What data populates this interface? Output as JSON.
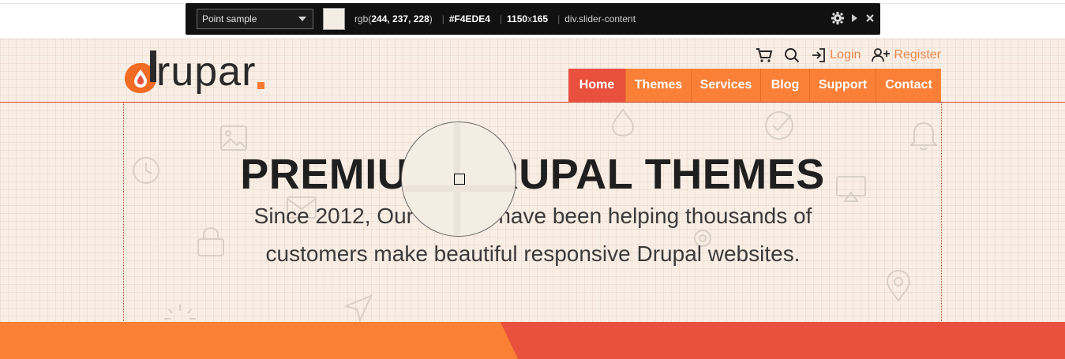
{
  "picker": {
    "mode": "Point sample",
    "rgb_prefix": "rgb(",
    "rgb_values": "244, 237, 228",
    "rgb_suffix": ")",
    "hex": "#F4EDE4",
    "width": "1150",
    "x_sep": "x",
    "height": "165",
    "element": "div.slider-content",
    "swatch_color": "#F4EDE4"
  },
  "brand": {
    "name": "rupar"
  },
  "utility": {
    "login": "Login",
    "register": "Register"
  },
  "nav": [
    {
      "label": "Home",
      "active": true
    },
    {
      "label": "Themes",
      "active": false
    },
    {
      "label": "Services",
      "active": false
    },
    {
      "label": "Blog",
      "active": false
    },
    {
      "label": "Support",
      "active": false
    },
    {
      "label": "Contact",
      "active": false
    }
  ],
  "hero": {
    "title": "PREMIUM DRUPAL THEMES",
    "subtitle": "Since 2012, Our themes have been helping thousands of customers make beautiful responsive Drupal websites."
  },
  "colors": {
    "accent_orange": "#FA8038",
    "accent_red": "#E9503E",
    "background": "#F4EDE4",
    "toolbar": "#111111"
  }
}
